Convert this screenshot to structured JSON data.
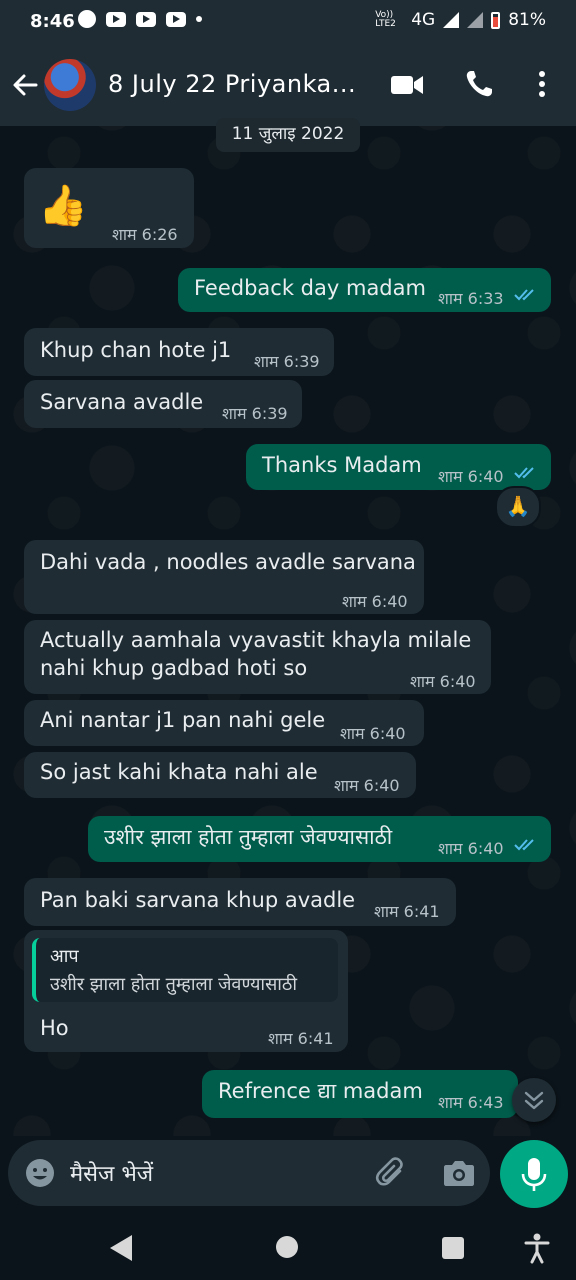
{
  "status_bar": {
    "time": "8:46",
    "network": "Vo)) LTE2",
    "signal": "4G",
    "battery": "81%"
  },
  "header": {
    "contact_name": "8 July 22 Priyanka...",
    "icons": [
      "back-arrow-icon",
      "video-call-icon",
      "phone-icon",
      "more-vert-icon"
    ]
  },
  "chat": {
    "date_label": "11 जुलाइ 2022",
    "messages": [
      {
        "dir": "in",
        "text": "👍",
        "time": "शाम 6:26"
      },
      {
        "dir": "out",
        "text": "Feedback day madam",
        "time": "शाम 6:33",
        "read": true
      },
      {
        "dir": "in",
        "text": "Khup chan hote j1",
        "time": "शाम 6:39"
      },
      {
        "dir": "in",
        "text": "Sarvana avadle",
        "time": "शाम 6:39"
      },
      {
        "dir": "out",
        "text": "Thanks Madam",
        "time": "शाम 6:40",
        "read": true,
        "reaction": "🙏"
      },
      {
        "dir": "in",
        "text": "Dahi vada , noodles avadle sarvana",
        "time": "शाम 6:40"
      },
      {
        "dir": "in",
        "text": "Actually aamhala vyavastit khayla milale\nnahi khup gadbad hoti so",
        "time": "शाम 6:40"
      },
      {
        "dir": "in",
        "text": "Ani nantar j1 pan nahi gele",
        "time": "शाम 6:40"
      },
      {
        "dir": "in",
        "text": "So jast kahi khata nahi ale",
        "time": "शाम 6:40"
      },
      {
        "dir": "out",
        "text": "उशीर झाला होता तुम्हाला जेवण्यासाठी",
        "time": "शाम 6:40",
        "read": true
      },
      {
        "dir": "in",
        "text": "Pan baki sarvana khup avadle",
        "time": "शाम 6:41"
      },
      {
        "dir": "in",
        "text": "Ho",
        "time": "शाम 6:41",
        "quote": {
          "author": "आप",
          "text": "उशीर झाला होता तुम्हाला जेवण्यासाठी"
        }
      },
      {
        "dir": "out",
        "text": "Refrence द्या madam",
        "time": "शाम 6:43"
      }
    ]
  },
  "composer": {
    "placeholder": "मैसेज भेजें"
  },
  "colors": {
    "incoming_bubble": "#1f2c34",
    "outgoing_bubble": "#005c4b",
    "read_ticks": "#53bdeb",
    "accent": "#00a884"
  }
}
